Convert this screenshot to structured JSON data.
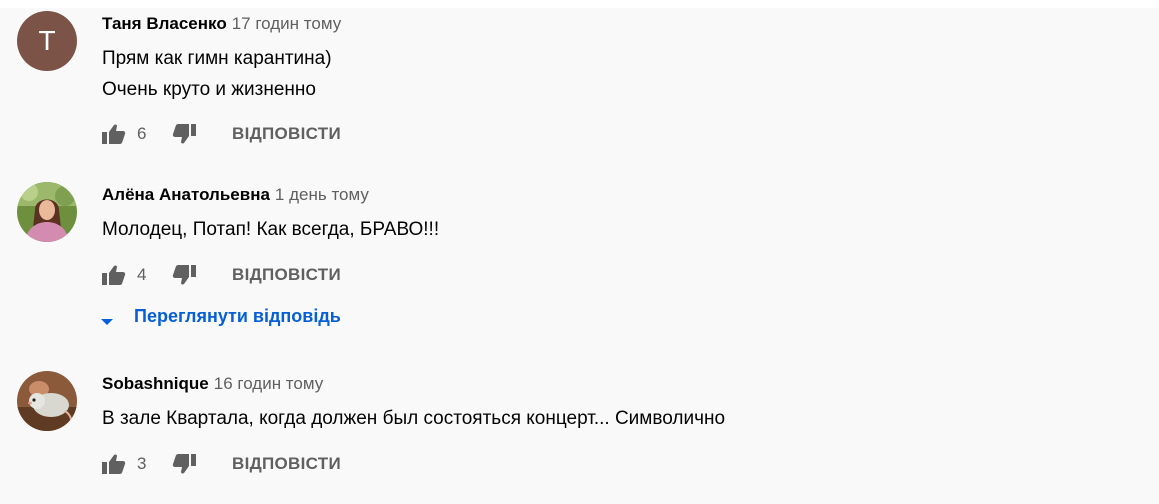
{
  "comments": [
    {
      "author": "Таня Власенко",
      "time": "17 годин тому",
      "avatar_letter": "Т",
      "lines": [
        "Прям как гимн карантина)",
        "Очень круто и жизненно"
      ],
      "likes": "6",
      "reply_label": "ВІДПОВІСТИ"
    },
    {
      "author": "Алёна Анатольевна",
      "time": "1 день тому",
      "lines": [
        "Молодец, Потап! Как всегда, БРАВО!!!"
      ],
      "likes": "4",
      "reply_label": "ВІДПОВІСТИ",
      "view_replies_label": "Переглянути відповідь"
    },
    {
      "author": "Sobashnique",
      "time": "16 годин тому",
      "lines": [
        "В зале Квартала, когда должен был состояться концерт... Символично"
      ],
      "likes": "3",
      "reply_label": "ВІДПОВІСТИ"
    }
  ],
  "colors": {
    "background": "#f9f9f9",
    "text": "#030303",
    "secondary_text": "#606060",
    "link": "#065fd4",
    "avatar_letter_bg": "#7b5447"
  },
  "icons": [
    "thumb-up-icon",
    "thumb-down-icon",
    "caret-down-icon"
  ]
}
